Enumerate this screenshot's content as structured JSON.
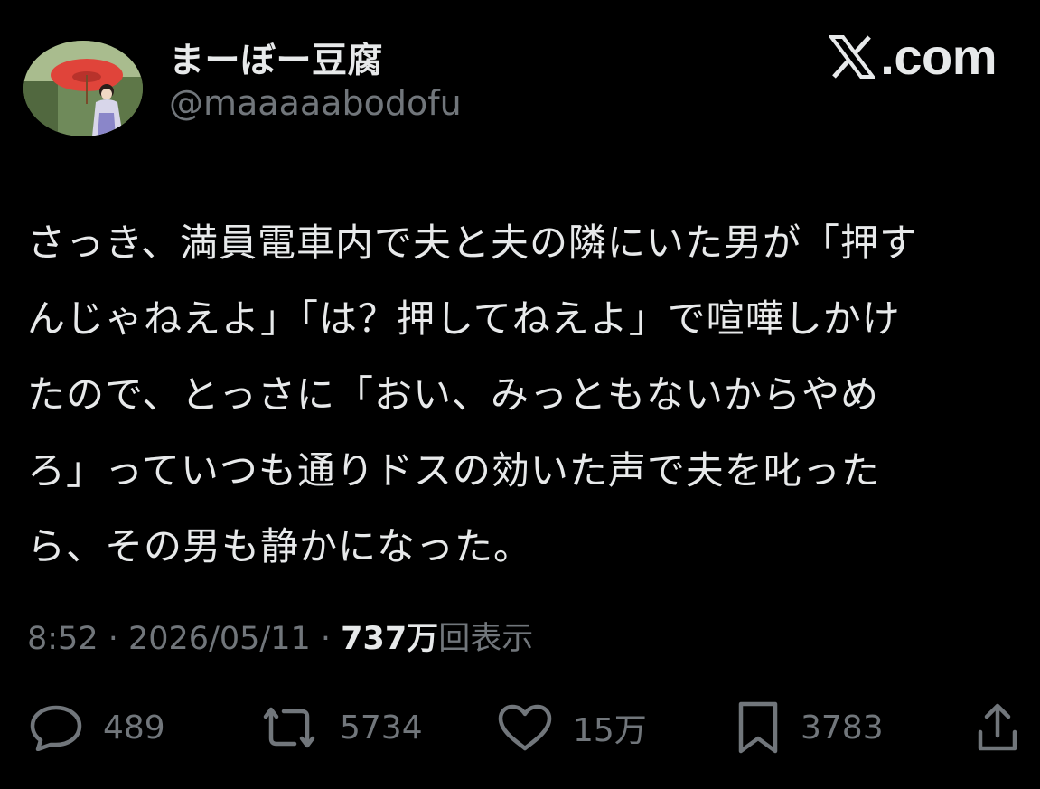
{
  "author": {
    "display_name": "まーぼー豆腐",
    "handle": "@maaaaabodofu",
    "avatar": "profile-photo"
  },
  "brand": {
    "icon": "x-logo",
    "text": ".com"
  },
  "tweet": {
    "lines": [
      "さっき、満員電車内で夫と夫の隣にいた男が「押す",
      "んじゃねえよ」「は？押してねえよ」で喧嘩しかけ",
      "たので、とっさに「おい、みっともないからやめ",
      "ろ」っていつも通りドスの効いた声で夫を叱った",
      "ら、その男も静かになった。"
    ]
  },
  "meta": {
    "time": "8:52",
    "sep1": " · ",
    "date": "2026/05/11",
    "sep2": " · ",
    "views_count": "737万",
    "views_label": "回表示"
  },
  "actions": {
    "reply": {
      "icon": "reply-icon",
      "count": "489"
    },
    "retweet": {
      "icon": "retweet-icon",
      "count": "5734"
    },
    "like": {
      "icon": "like-icon",
      "count": "15万"
    },
    "bookmark": {
      "icon": "bookmark-icon",
      "count": "3783"
    },
    "share": {
      "icon": "share-icon"
    }
  },
  "colors": {
    "background": "#000000",
    "primary_text": "#e7e9ea",
    "secondary_text": "#71767b"
  }
}
